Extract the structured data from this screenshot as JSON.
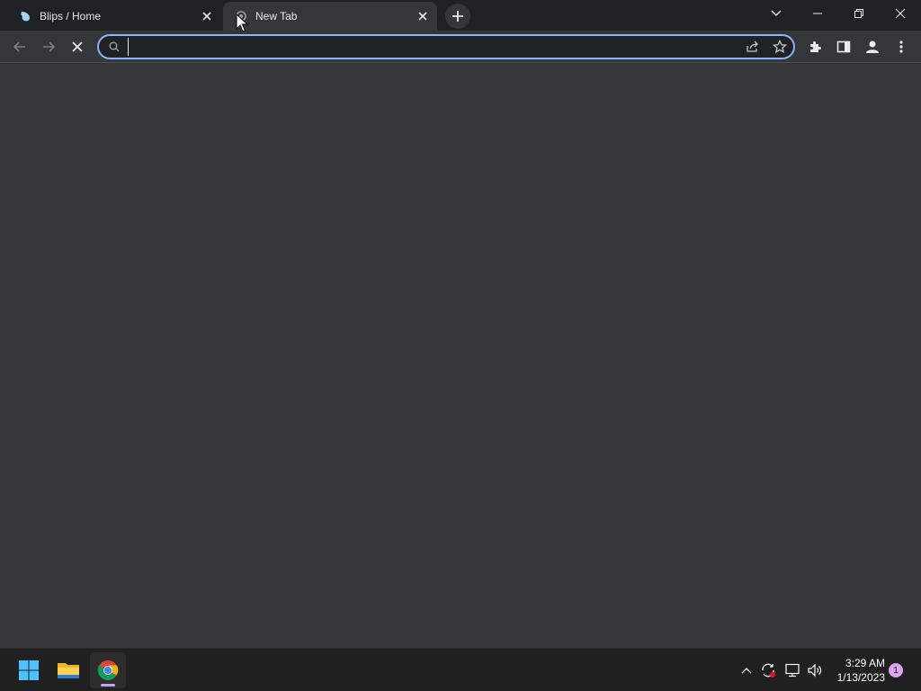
{
  "browser": {
    "tabs": [
      {
        "title": "Blips / Home",
        "favicon": "blips-bird-icon",
        "active": false
      },
      {
        "title": "New Tab",
        "favicon": "loading-spinner-icon",
        "active": true
      }
    ],
    "omnibox": {
      "value": "",
      "placeholder": ""
    },
    "colors": {
      "frame": "#202124",
      "toolbar": "#35363a",
      "focus_ring": "#8ab4f8",
      "text": "#e8eaed"
    }
  },
  "taskbar": {
    "apps": [
      {
        "name": "Start",
        "icon": "windows-start-icon"
      },
      {
        "name": "File Explorer",
        "icon": "file-explorer-icon"
      },
      {
        "name": "Google Chrome",
        "icon": "chrome-icon",
        "active": true
      }
    ],
    "clock": {
      "time": "3:29 AM",
      "date": "1/13/2023"
    },
    "notification_count": "1"
  }
}
